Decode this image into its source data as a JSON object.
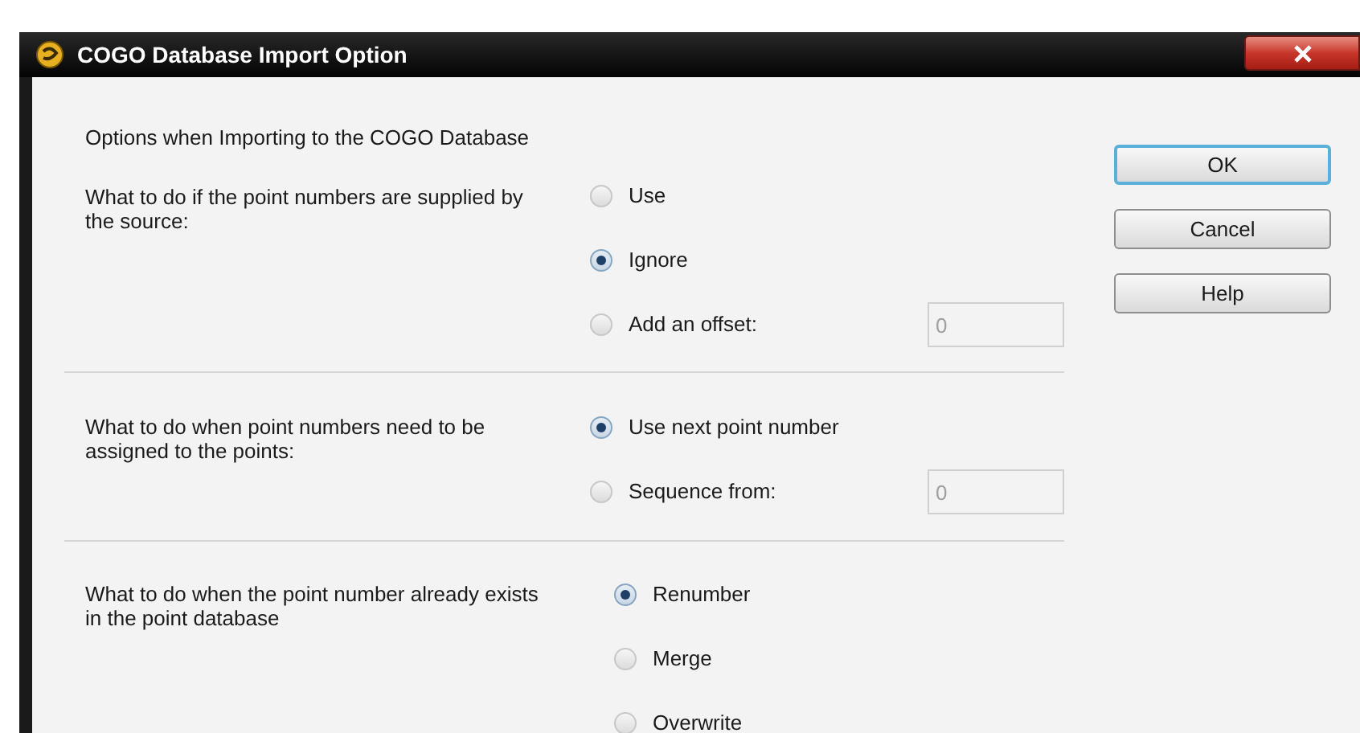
{
  "window": {
    "title": "COGO Database Import Option"
  },
  "heading": "Options when Importing to the COGO Database",
  "sections": [
    {
      "label": "What to do if the point numbers are supplied by the source:",
      "options": [
        {
          "label": "Use",
          "selected": false
        },
        {
          "label": "Ignore",
          "selected": true
        },
        {
          "label": "Add an offset:",
          "selected": false,
          "field": {
            "value": "0",
            "disabled": true
          }
        }
      ]
    },
    {
      "label": "What to do when point numbers need to be assigned to the points:",
      "options": [
        {
          "label": "Use next point number",
          "selected": true
        },
        {
          "label": "Sequence from:",
          "selected": false,
          "field": {
            "value": "0",
            "disabled": true
          }
        }
      ]
    },
    {
      "label": "What to do when the point number already exists in the point database",
      "options": [
        {
          "label": "Renumber",
          "selected": true
        },
        {
          "label": "Merge",
          "selected": false
        },
        {
          "label": "Overwrite",
          "selected": false
        }
      ]
    }
  ],
  "buttons": [
    {
      "label": "OK",
      "default": true
    },
    {
      "label": "Cancel",
      "default": false
    },
    {
      "label": "Help",
      "default": false
    }
  ]
}
